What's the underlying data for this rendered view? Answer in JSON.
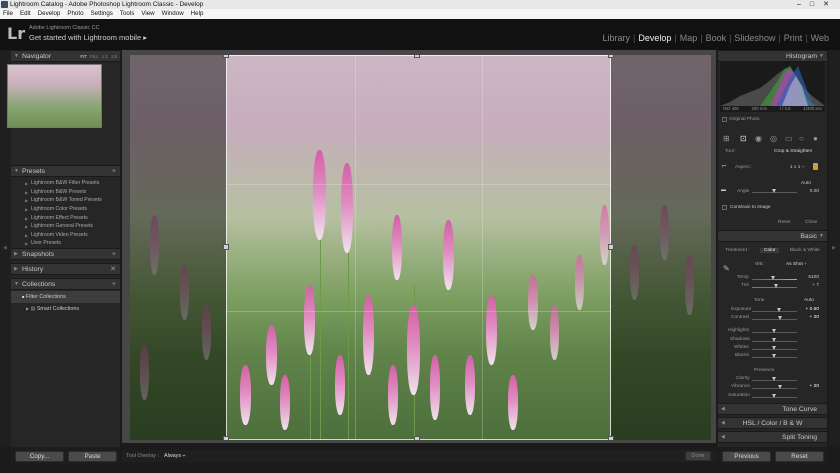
{
  "window": {
    "title": "Lightroom Catalog - Adobe Photoshop Lightroom Classic - Develop",
    "controls": "–□✕"
  },
  "menu": [
    "File",
    "Edit",
    "Develop",
    "Photo",
    "Settings",
    "Tools",
    "View",
    "Window",
    "Help"
  ],
  "identity": {
    "logo": "Lr",
    "product": "Adobe Lightroom Classic CC",
    "subtitle": "Get started with Lightroom mobile ▸"
  },
  "modules": [
    {
      "label": "Library",
      "active": false
    },
    {
      "label": "Develop",
      "active": true
    },
    {
      "label": "Map",
      "active": false
    },
    {
      "label": "Book",
      "active": false
    },
    {
      "label": "Slideshow",
      "active": false
    },
    {
      "label": "Print",
      "active": false
    },
    {
      "label": "Web",
      "active": false
    }
  ],
  "navigator": {
    "title": "Navigator",
    "zoom": [
      "FIT",
      "FILL",
      "1:1",
      "1:8"
    ]
  },
  "presets": {
    "title": "Presets",
    "items": [
      "Lightroom B&W Filter Presets",
      "Lightroom B&W Presets",
      "Lightroom B&W Toned Presets",
      "Lightroom Color Presets",
      "Lightroom Effect Presets",
      "Lightroom General Presets",
      "Lightroom Video Presets",
      "User Presets"
    ]
  },
  "snapshots": {
    "title": "Snapshots"
  },
  "history": {
    "title": "History"
  },
  "collections": {
    "title": "Collections",
    "items": [
      "Filter Collections",
      "Smart Collections"
    ]
  },
  "left_buttons": {
    "copy": "Copy...",
    "paste": "Paste"
  },
  "toolbar": {
    "label": "Tool Overlay :",
    "value": "Always ÷",
    "done": "Done"
  },
  "histogram": {
    "title": "Histogram",
    "info": [
      "ISO 400",
      "200 mm",
      "f / 2.8",
      "1/400 sec"
    ],
    "original_photo": "Original Photo"
  },
  "crop": {
    "tool": "Tool :",
    "tool_name": "Crop & Straighten",
    "aspect_label": "Aspect :",
    "aspect_value": "1 x 1 ÷",
    "auto": "Auto",
    "angle_label": "Angle",
    "angle_value": "0.00",
    "constrain": "Constrain to Image",
    "reset": "Reset",
    "close": "Close"
  },
  "basic": {
    "title": "Basic",
    "treatment_label": "Treatment :",
    "treatments": [
      "Color",
      "Black & White"
    ],
    "wb_label": "WB :",
    "wb_value": "As Shot ÷",
    "temp_label": "Temp",
    "temp_value": "5100",
    "tint_label": "Tint",
    "tint_value": "+ 7",
    "tone_label": "Tone",
    "tone_auto": "Auto",
    "exposure_label": "Exposure",
    "exposure_value": "+ 0.50",
    "contrast_label": "Contrast",
    "contrast_value": "+ 20",
    "tone_rows": [
      "Highlights",
      "Shadows",
      "Whites",
      "Blacks"
    ],
    "presence_label": "Presence",
    "clarity_label": "Clarity",
    "vibrance_label": "Vibrance",
    "vibrance_value": "+ 20",
    "saturation_label": "Saturation"
  },
  "tone_curve": {
    "title": "Tone Curve"
  },
  "hsl": {
    "label": "HSL / Color / B & W"
  },
  "split_toning": {
    "title": "Split Toning"
  },
  "right_buttons": {
    "previous": "Previous",
    "reset": "Reset"
  }
}
